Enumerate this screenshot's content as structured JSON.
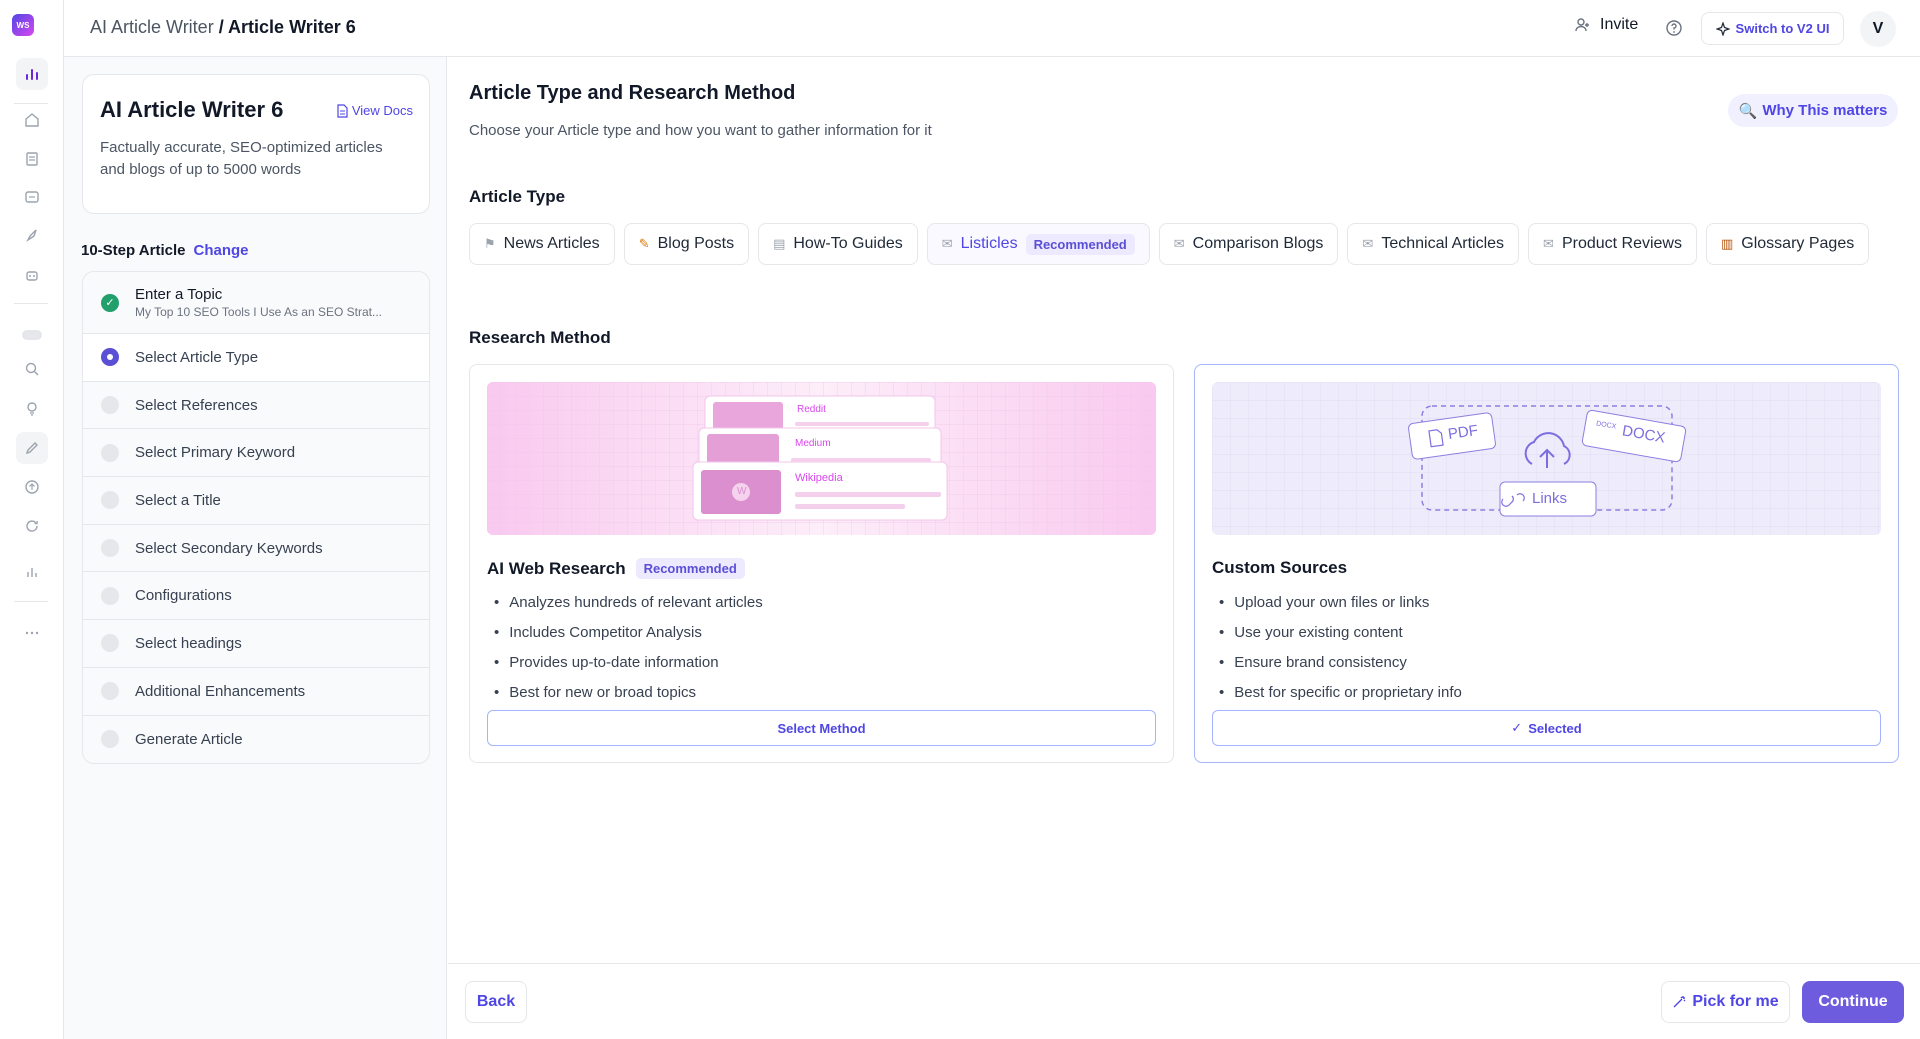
{
  "rail": {
    "logo": "WS"
  },
  "header": {
    "crumb_root": "AI Article Writer",
    "crumb_sep": " / ",
    "crumb_current": "Article Writer 6",
    "invite": "Invite",
    "switch_label": "Switch to V2 UI",
    "avatar": "V"
  },
  "info": {
    "title": "AI Article Writer 6",
    "view_docs": "View Docs",
    "description": "Factually accurate, SEO-optimized articles and blogs of up to 5000 words"
  },
  "steps_header": {
    "label": "10-Step Article",
    "change": "Change"
  },
  "steps": [
    {
      "label": "Enter a Topic",
      "sub": "My Top 10 SEO Tools I Use As an SEO Strat...",
      "state": "done"
    },
    {
      "label": "Select Article Type",
      "state": "current"
    },
    {
      "label": "Select References",
      "state": "pending"
    },
    {
      "label": "Select Primary Keyword",
      "state": "pending"
    },
    {
      "label": "Select a Title",
      "state": "pending"
    },
    {
      "label": "Select Secondary Keywords",
      "state": "pending"
    },
    {
      "label": "Configurations",
      "state": "pending"
    },
    {
      "label": "Select headings",
      "state": "pending"
    },
    {
      "label": "Additional Enhancements",
      "state": "pending"
    },
    {
      "label": "Generate Article",
      "state": "pending"
    }
  ],
  "main": {
    "title": "Article Type and Research Method",
    "subtitle": "Choose your Article type and how you want to gather information for it",
    "why": "Why This matters",
    "article_type_heading": "Article Type",
    "research_heading": "Research Method"
  },
  "article_types": [
    {
      "label": "News Articles",
      "icon": "flag-icon"
    },
    {
      "label": "Blog Posts",
      "icon": "pencil-icon"
    },
    {
      "label": "How-To Guides",
      "icon": "book-icon"
    },
    {
      "label": "Listicles",
      "icon": "mail-icon",
      "badge": "Recommended",
      "selected": true
    },
    {
      "label": "Comparison Blogs",
      "icon": "mail-icon"
    },
    {
      "label": "Technical Articles",
      "icon": "mail-icon"
    },
    {
      "label": "Product Reviews",
      "icon": "mail-icon"
    },
    {
      "label": "Glossary Pages",
      "icon": "books-icon"
    }
  ],
  "methods": {
    "web": {
      "title": "AI Web Research",
      "badge": "Recommended",
      "bullets": [
        "Analyzes hundreds of relevant articles",
        "Includes Competitor Analysis",
        "Provides up-to-date information",
        "Best for new or broad topics"
      ],
      "button": "Select Method",
      "art": {
        "reddit": "Reddit",
        "medium": "Medium",
        "wikipedia": "Wikipedia",
        "w": "W"
      }
    },
    "custom": {
      "title": "Custom Sources",
      "bullets": [
        "Upload your own files or links",
        "Use your existing content",
        "Ensure brand consistency",
        "Best for specific or proprietary info"
      ],
      "button": "Selected",
      "art": {
        "pdf": "PDF",
        "docx": "DOCX",
        "docx_small": "DOCX",
        "links": "Links"
      }
    }
  },
  "footer": {
    "back": "Back",
    "pick": "Pick for me",
    "continue": "Continue"
  },
  "colors": {
    "accent": "#4f46e5",
    "primary_button": "#6d5dde",
    "done": "#22a06b"
  }
}
